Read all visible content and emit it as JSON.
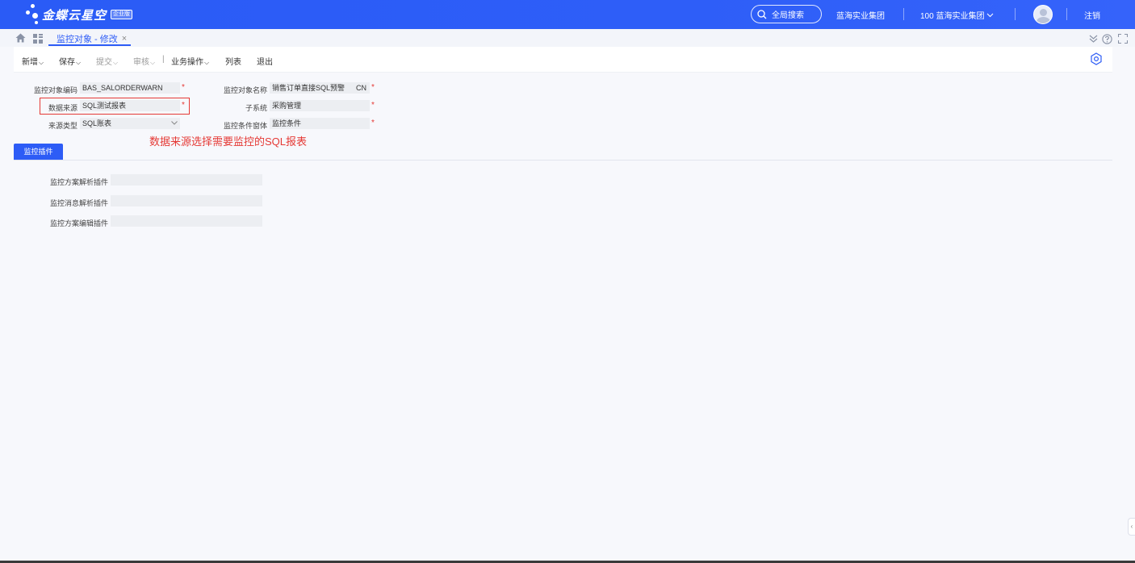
{
  "header": {
    "logo_text": "金蝶云星空",
    "logo_badge": "企业版",
    "search_label": "全局搜索",
    "org_group": "蓝海实业集团",
    "org_select": "100 蓝海实业集团",
    "logout": "注销"
  },
  "tabs": {
    "active_tab": "监控对象 - 修改",
    "close": "×"
  },
  "toolbar": {
    "new": "新增",
    "save": "保存",
    "submit": "提交",
    "audit": "审核",
    "business_ops": "业务操作",
    "list": "列表",
    "exit": "退出",
    "separator": "|",
    "dropdown_mark": "⌵"
  },
  "form": {
    "code_label": "监控对象编码",
    "code_value": "BAS_SALORDERWARN",
    "name_label": "监控对象名称",
    "name_value": "销售订单直接SQL预警",
    "name_lang": "CN",
    "source_label": "数据来源",
    "source_value": "SQL测试报表",
    "subsystem_label": "子系统",
    "subsystem_value": "采购管理",
    "source_type_label": "来源类型",
    "source_type_value": "SQL账表",
    "condition_label": "监控条件窗体",
    "condition_value": "监控条件",
    "required_mark": "*"
  },
  "annotation": {
    "text": "数据来源选择需要监控的SQL报表",
    "color": "#e53935"
  },
  "plugins": {
    "tab_label": "监控插件",
    "scheme_parse_label": "监控方案解析插件",
    "message_parse_label": "监控消息解析插件",
    "scheme_edit_label": "监控方案编辑插件"
  },
  "side_handle": "‹",
  "colors": {
    "header_blue": "#2d5cf6",
    "required_red": "#e53935"
  }
}
